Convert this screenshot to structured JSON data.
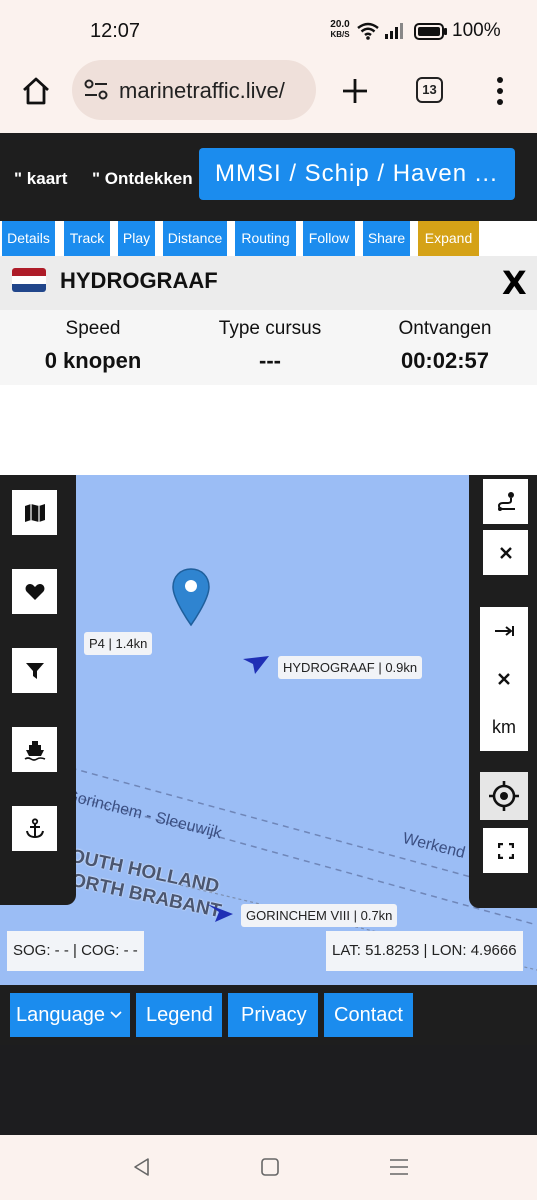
{
  "status": {
    "time": "12:07",
    "net_speed_value": "20.0",
    "net_speed_unit": "KB/S",
    "battery": "100%"
  },
  "browser": {
    "url": "marinetraffic.live/",
    "tab_count": "13"
  },
  "nav": {
    "link1": "\" kaart",
    "link2": "\" Ontdekken",
    "search_placeholder": "MMSI / Schip / Haven ..."
  },
  "tabs": [
    "Details",
    "Track",
    "Play",
    "Distance",
    "Routing",
    "Follow",
    "Share",
    "Expand"
  ],
  "ship": {
    "name": "HYDROGRAAF",
    "close": "X",
    "flag_colors": [
      "#ae1c28",
      "#ffffff",
      "#21468b"
    ]
  },
  "stats": [
    {
      "label": "Speed",
      "value": "0 knopen"
    },
    {
      "label": "Type cursus",
      "value": "---"
    },
    {
      "label": "Ontvangen",
      "value": "00:02:57"
    }
  ],
  "map": {
    "labels": {
      "p4": "P4 | 1.4kn",
      "hydrograaf": "HYDROGRAAF | 0.9kn",
      "gorinchem": "GORINCHEM VIII | 0.7kn",
      "route1": "Gorinchem - Sleeuwijk",
      "route2": "Werkend",
      "region1": "SOUTH HOLLAND",
      "region2": "NORTH BRABANT"
    },
    "sog_cog": "SOG: - - | COG: - -",
    "latlon": "LAT: 51.8253 | LON: 4.9666",
    "scale_unit": "km",
    "water_color": "#9bbdf5"
  },
  "footer": {
    "language": "Language",
    "legend": "Legend",
    "privacy": "Privacy",
    "contact": "Contact"
  },
  "colors": {
    "accent": "#1b8cee",
    "expand": "#d5a217",
    "panel": "#1e1e1e"
  }
}
